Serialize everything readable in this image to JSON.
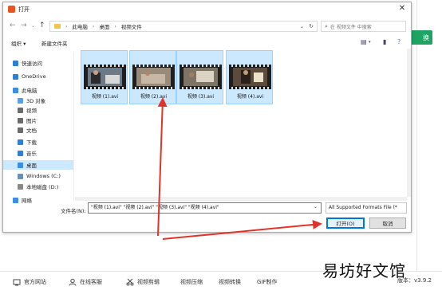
{
  "background_app": {
    "green_button": "换",
    "bottom_bar": [
      {
        "icon": "home-icon",
        "label": "官方网站"
      },
      {
        "icon": "user-icon",
        "label": "在线客服"
      },
      {
        "icon": "scissors-icon",
        "label": "视频剪辑"
      },
      {
        "icon": "",
        "label": "视频压缩"
      },
      {
        "icon": "",
        "label": "视频转换"
      },
      {
        "icon": "",
        "label": "GIF制作"
      }
    ],
    "version": "版本：v3.9.2",
    "watermark": "易坊好文馆"
  },
  "dialog": {
    "title": "打开",
    "close": "✕",
    "address": [
      "此电脑",
      "桌面",
      "视频文件"
    ],
    "search_placeholder": "在 视频文件 中搜索",
    "toolbar": {
      "organize": "组织 ▾",
      "new_folder": "新建文件夹"
    },
    "nav_items": [
      {
        "label": "快速访问",
        "icon": "star-icon",
        "color": "#2f7fd6"
      },
      {
        "label": "OneDrive",
        "icon": "cloud-icon",
        "color": "#2f7fd6"
      },
      {
        "label": "此电脑",
        "icon": "computer-icon",
        "color": "#3a8ee6"
      },
      {
        "label": "3D 对象",
        "icon": "cube-icon",
        "color": "#5aa0e6"
      },
      {
        "label": "视频",
        "icon": "video-icon",
        "color": "#6b6b6b"
      },
      {
        "label": "图片",
        "icon": "picture-icon",
        "color": "#6b6b6b"
      },
      {
        "label": "文档",
        "icon": "document-icon",
        "color": "#6b6b6b"
      },
      {
        "label": "下载",
        "icon": "download-icon",
        "color": "#2f7fd6"
      },
      {
        "label": "音乐",
        "icon": "music-icon",
        "color": "#2f7fd6"
      },
      {
        "label": "桌面",
        "icon": "desktop-icon",
        "color": "#3a8ee6"
      },
      {
        "label": "Windows (C:)",
        "icon": "drive-icon",
        "color": "#6b8fb5"
      },
      {
        "label": "本地磁盘 (D:)",
        "icon": "drive-icon",
        "color": "#888888"
      },
      {
        "label": "网络",
        "icon": "network-icon",
        "color": "#3a8ee6"
      }
    ],
    "files": [
      {
        "name": "视频 (1).avi"
      },
      {
        "name": "视频 (2).avi"
      },
      {
        "name": "视频 (3).avi"
      },
      {
        "name": "视频 (4).avi"
      }
    ],
    "filename_label": "文件名(N):",
    "filename_value": "\"视频 (1).avi\" \"视频 (2).avi\" \"视频 (3).avi\" \"视频 (4).avi\"",
    "filetype": "All Supported Formats File (*",
    "open_button": "打开(O)",
    "cancel_button": "取消"
  },
  "colors": {
    "accent": "#0078d7",
    "selection": "#cce8ff",
    "annotation_arrow": "#e0342a",
    "brand_green": "#1ea362"
  }
}
